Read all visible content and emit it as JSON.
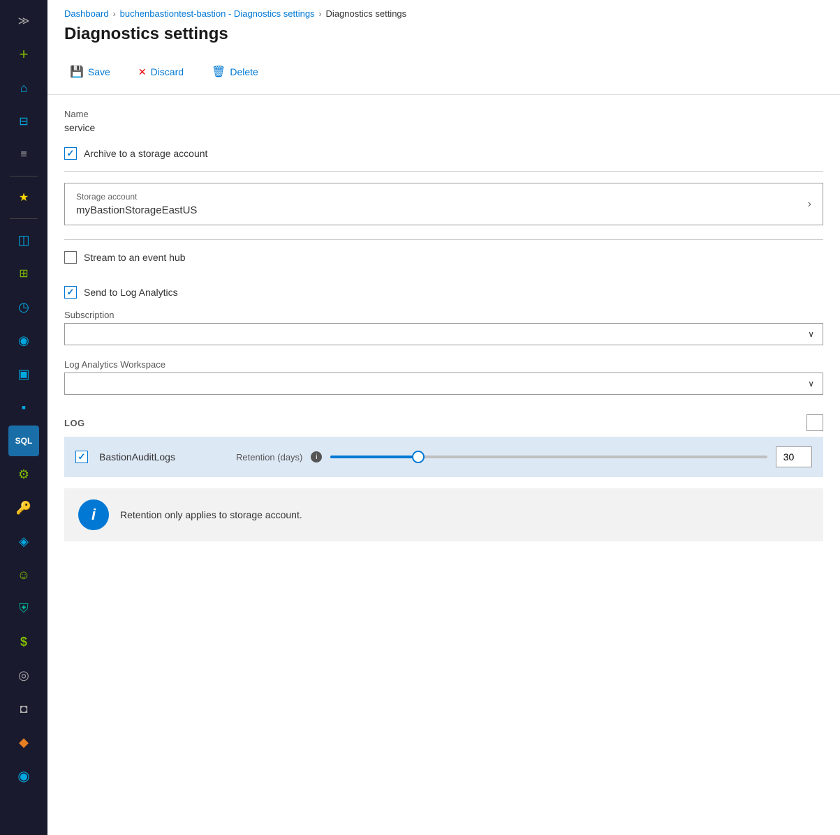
{
  "breadcrumb": {
    "items": [
      {
        "label": "Dashboard",
        "link": true
      },
      {
        "label": "buchenbastiontest-bastion - Diagnostics settings",
        "link": true
      },
      {
        "label": "Diagnostics settings",
        "link": false
      }
    ]
  },
  "pageTitle": "Diagnostics settings",
  "toolbar": {
    "save": "Save",
    "discard": "Discard",
    "delete": "Delete"
  },
  "form": {
    "nameLabel": "Name",
    "nameValue": "service",
    "archiveCheckbox": {
      "label": "Archive to a storage account",
      "checked": true
    },
    "storageAccount": {
      "label": "Storage account",
      "value": "myBastionStorageEastUS"
    },
    "eventHubCheckbox": {
      "label": "Stream to an event hub",
      "checked": false
    },
    "logAnalyticsCheckbox": {
      "label": "Send to Log Analytics",
      "checked": true
    },
    "subscription": {
      "label": "Subscription",
      "placeholder": "",
      "value": ""
    },
    "logAnalyticsWorkspace": {
      "label": "Log Analytics Workspace",
      "placeholder": "",
      "value": ""
    }
  },
  "logSection": {
    "title": "LOG",
    "rows": [
      {
        "name": "BastionAuditLogs",
        "checked": true,
        "retentionLabel": "Retention (days)",
        "retentionValue": "30"
      }
    ]
  },
  "notice": {
    "text": "Retention only applies to storage account."
  },
  "sidebar": {
    "icons": [
      {
        "name": "expand-icon",
        "symbol": "≫"
      },
      {
        "name": "add-icon",
        "symbol": "+"
      },
      {
        "name": "home-icon",
        "symbol": "⌂"
      },
      {
        "name": "dashboard-icon",
        "symbol": "⊞"
      },
      {
        "name": "list-icon",
        "symbol": "≡"
      },
      {
        "name": "favorites-icon",
        "symbol": "★"
      },
      {
        "name": "box-icon",
        "symbol": "◫"
      },
      {
        "name": "grid-icon",
        "symbol": "⊞"
      },
      {
        "name": "clock-icon",
        "symbol": "○"
      },
      {
        "name": "globe-icon",
        "symbol": "◉"
      },
      {
        "name": "monitor-icon",
        "symbol": "▣"
      },
      {
        "name": "screen-icon",
        "symbol": "▪"
      },
      {
        "name": "sql-icon",
        "symbol": "S"
      },
      {
        "name": "settings2-icon",
        "symbol": "✱"
      },
      {
        "name": "key-icon",
        "symbol": "⚷"
      },
      {
        "name": "diamond-icon",
        "symbol": "◈"
      },
      {
        "name": "face-icon",
        "symbol": "☺"
      },
      {
        "name": "shield-icon",
        "symbol": "⛨"
      },
      {
        "name": "dollar-icon",
        "symbol": "$"
      },
      {
        "name": "headset-icon",
        "symbol": "◎"
      },
      {
        "name": "shield2-icon",
        "symbol": "◘"
      },
      {
        "name": "badge-icon",
        "symbol": "◆"
      },
      {
        "name": "user-circle-icon",
        "symbol": "◉"
      }
    ]
  }
}
